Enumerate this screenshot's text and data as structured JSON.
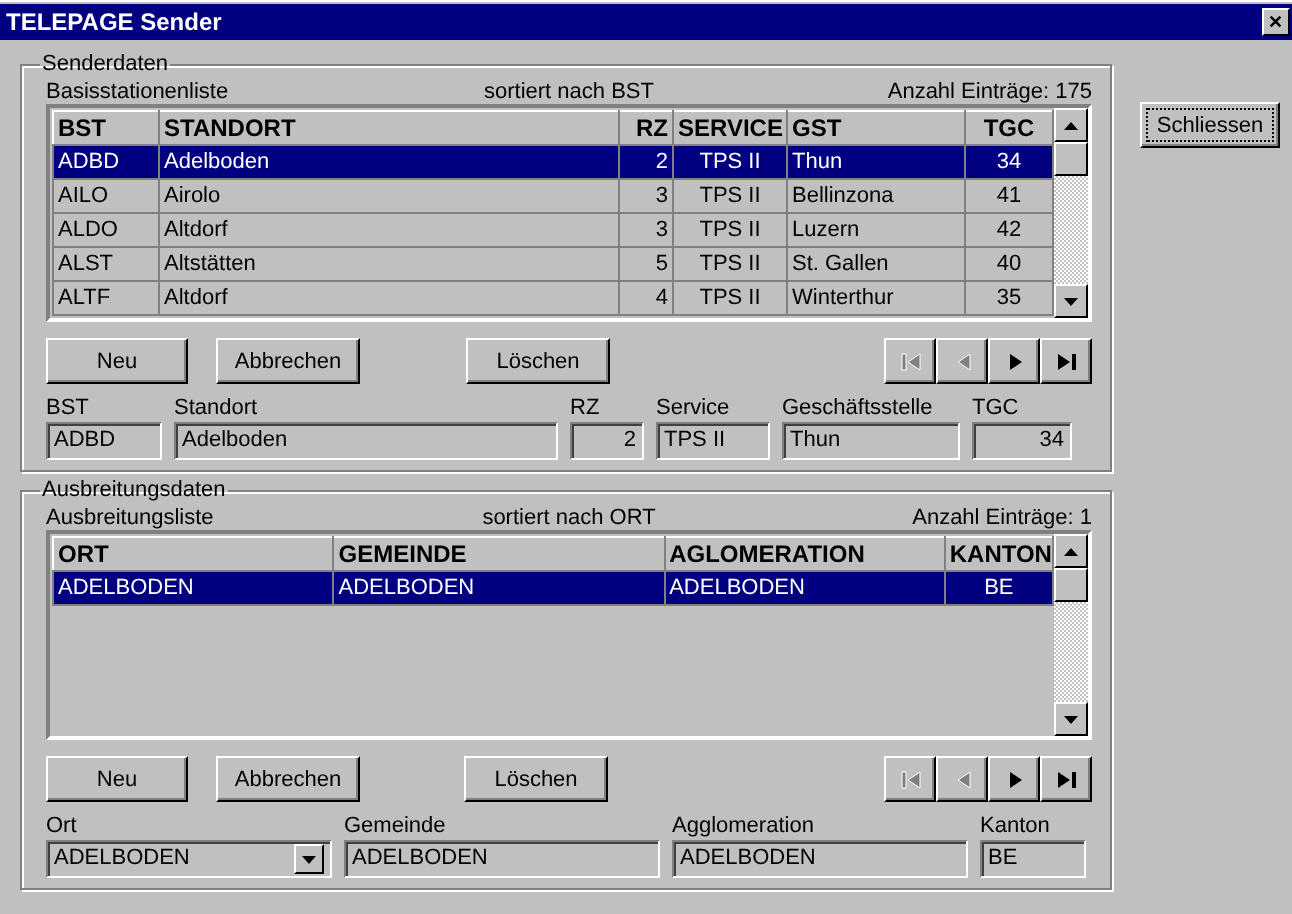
{
  "window": {
    "title": "TELEPAGE Sender",
    "close": "✕"
  },
  "close_button": "Schliessen",
  "sections": [
    {
      "legend": "Senderdaten",
      "list_label": "Basisstationenliste",
      "sort_label": "sortiert nach BST",
      "count_label": "Anzahl Einträge: 175",
      "columns": [
        "BST",
        "STANDORT",
        "RZ",
        "SERVICE",
        "GST",
        "TGC"
      ],
      "rows": [
        {
          "selected": true,
          "cells": [
            "ADBD",
            "Adelboden",
            "2",
            "TPS II",
            "Thun",
            "34"
          ]
        },
        {
          "selected": false,
          "cells": [
            "AILO",
            "Airolo",
            "3",
            "TPS II",
            "Bellinzona",
            "41"
          ]
        },
        {
          "selected": false,
          "cells": [
            "ALDO",
            "Altdorf",
            "3",
            "TPS II",
            "Luzern",
            "42"
          ]
        },
        {
          "selected": false,
          "cells": [
            "ALST",
            "Altstätten",
            "5",
            "TPS II",
            "St. Gallen",
            "40"
          ]
        },
        {
          "selected": false,
          "cells": [
            "ALTF",
            "Altdorf",
            "4",
            "TPS II",
            "Winterthur",
            "35"
          ]
        }
      ],
      "buttons": [
        "Neu",
        "Abbrechen",
        "Löschen"
      ],
      "nav": [
        {
          "kind": "first",
          "disabled": true
        },
        {
          "kind": "prev",
          "disabled": true
        },
        {
          "kind": "next",
          "disabled": false
        },
        {
          "kind": "last",
          "disabled": false
        }
      ],
      "fields": [
        {
          "label": "BST",
          "value": "ADBD",
          "kind": "text"
        },
        {
          "label": "Standort",
          "value": "Adelboden",
          "kind": "text"
        },
        {
          "label": "RZ",
          "value": "2",
          "kind": "number"
        },
        {
          "label": "Service",
          "value": "TPS II",
          "kind": "text"
        },
        {
          "label": "Geschäftsstelle",
          "value": "Thun",
          "kind": "text"
        },
        {
          "label": "TGC",
          "value": "34",
          "kind": "number"
        }
      ]
    },
    {
      "legend": "Ausbreitungsdaten",
      "list_label": "Ausbreitungsliste",
      "sort_label": "sortiert nach ORT",
      "count_label": "Anzahl Einträge: 1",
      "columns": [
        "ORT",
        "GEMEINDE",
        "AGLOMERATION",
        "KANTON"
      ],
      "rows": [
        {
          "selected": true,
          "cells": [
            "ADELBODEN",
            "ADELBODEN",
            "ADELBODEN",
            "BE"
          ]
        }
      ],
      "buttons": [
        "Neu",
        "Abbrechen",
        "Löschen"
      ],
      "nav": [
        {
          "kind": "first",
          "disabled": true
        },
        {
          "kind": "prev",
          "disabled": true
        },
        {
          "kind": "next",
          "disabled": false
        },
        {
          "kind": "last",
          "disabled": false
        }
      ],
      "fields": [
        {
          "label": "Ort",
          "value": "ADELBODEN",
          "kind": "combo"
        },
        {
          "label": "Gemeinde",
          "value": "ADELBODEN",
          "kind": "text"
        },
        {
          "label": "Agglomeration",
          "value": "ADELBODEN",
          "kind": "text"
        },
        {
          "label": "Kanton",
          "value": "BE",
          "kind": "text"
        }
      ]
    }
  ]
}
